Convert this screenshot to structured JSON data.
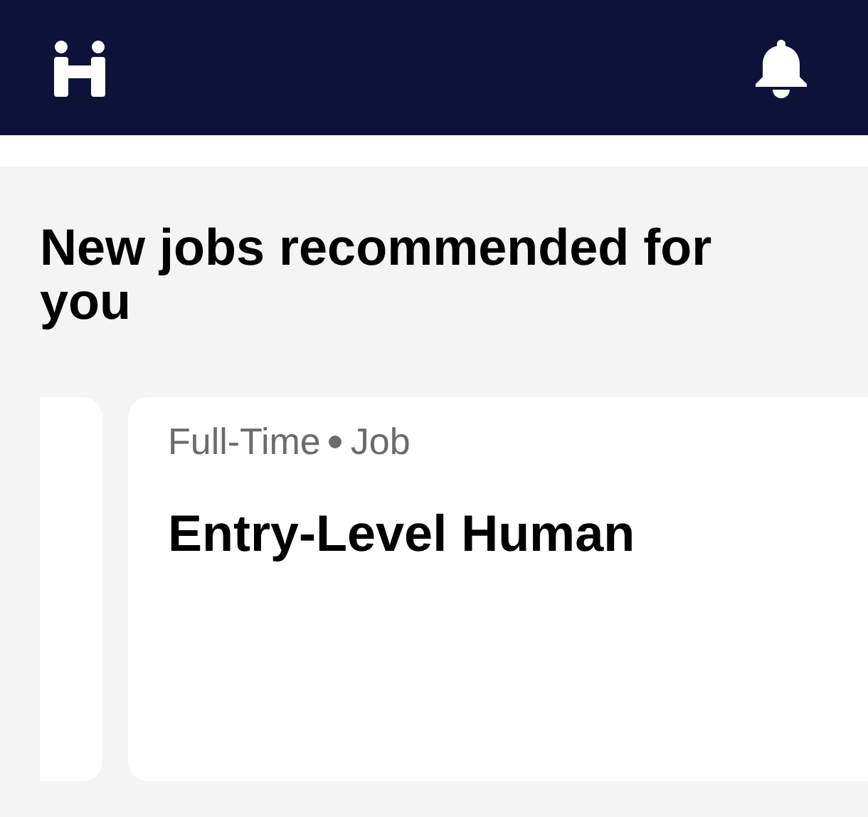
{
  "section": {
    "heading": "New jobs recommended for you"
  },
  "cards": [
    {
      "kind": "partial"
    },
    {
      "kind": "job",
      "tags": [
        "Full-Time",
        "Job"
      ],
      "title": "Entry-Level Human"
    }
  ]
}
